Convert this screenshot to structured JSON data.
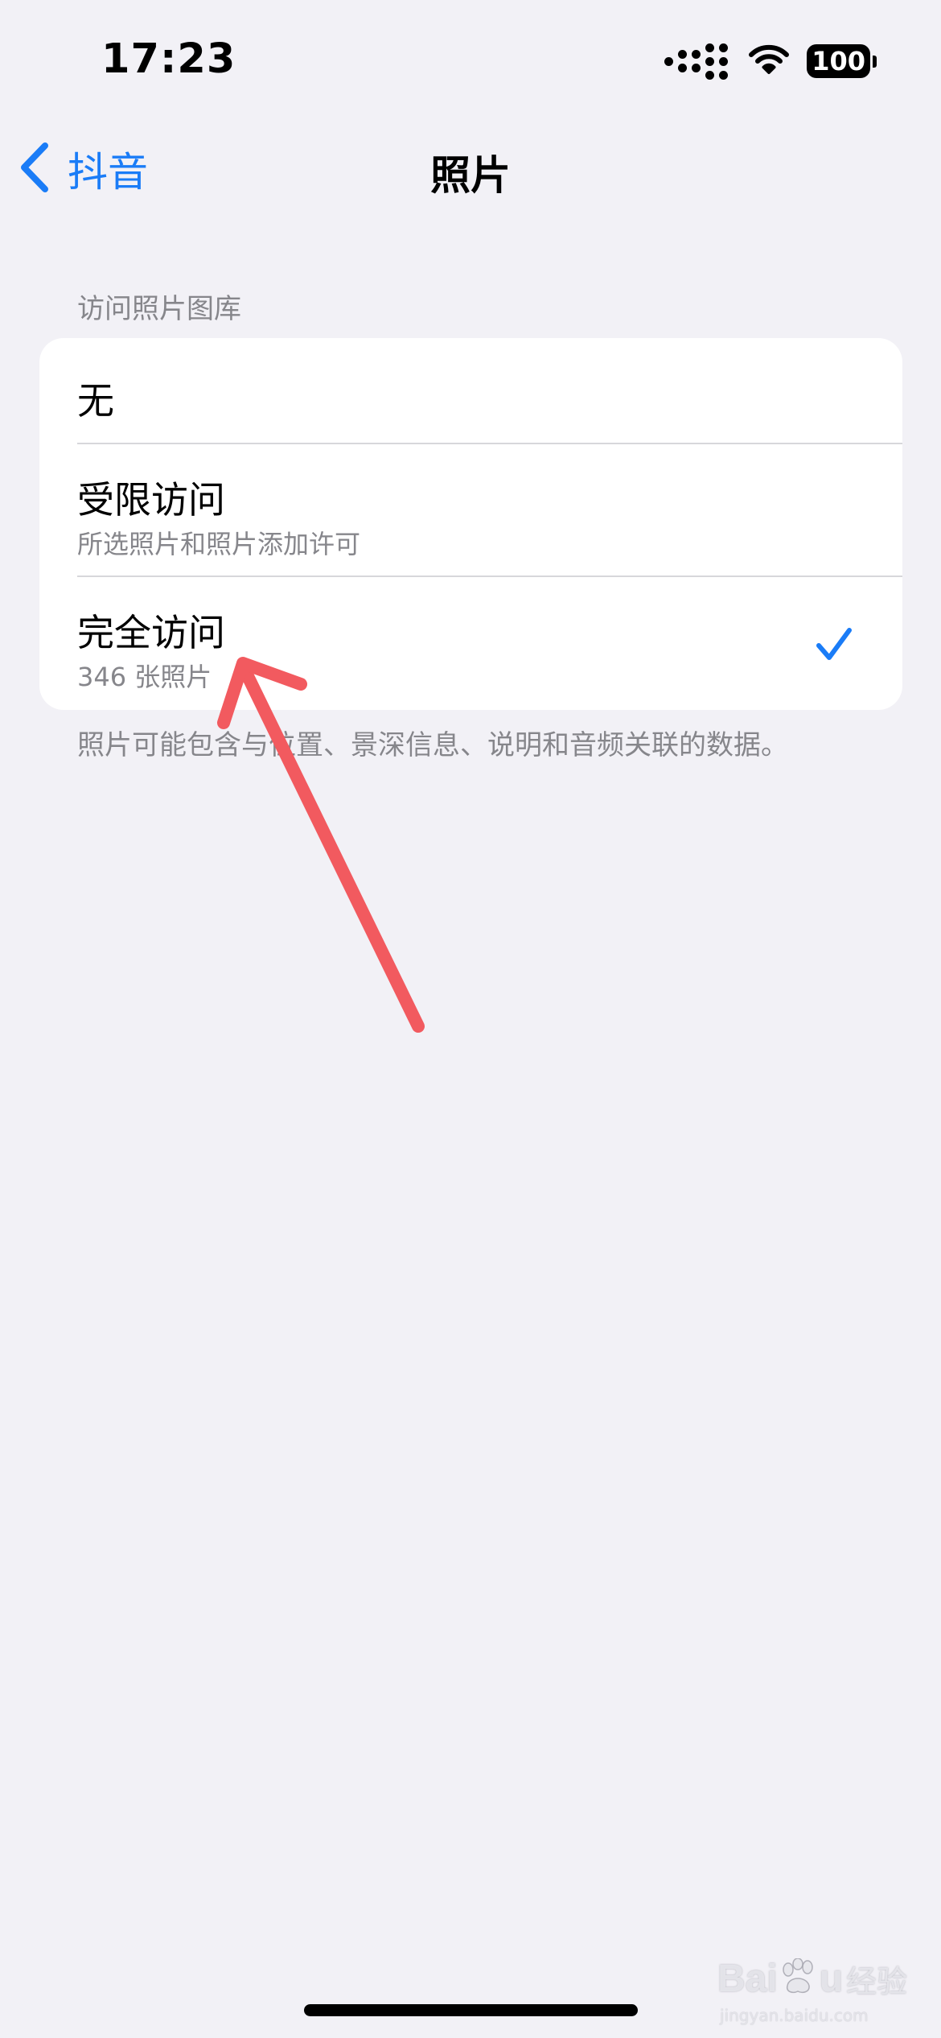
{
  "status_bar": {
    "time": "17:23",
    "battery": "100",
    "icons": [
      "signal-icon",
      "wifi-icon",
      "battery-icon"
    ]
  },
  "nav": {
    "back_label": "抖音",
    "title": "照片"
  },
  "section": {
    "header": "访问照片图库",
    "options": [
      {
        "title": "无",
        "subtitle": "",
        "selected": false
      },
      {
        "title": "受限访问",
        "subtitle": "所选照片和照片添加许可",
        "selected": false
      },
      {
        "title": "完全访问",
        "subtitle": "346 张照片",
        "selected": true
      }
    ],
    "footer": "照片可能包含与位置、景深信息、说明和音频关联的数据。"
  },
  "watermark": {
    "logo_left": "Bai",
    "logo_right": "u",
    "text": "经验",
    "url": "jingyan.baidu.com"
  },
  "colors": {
    "accent": "#1a7cf7",
    "background": "#f2f1f6",
    "annotation_arrow": "#f25a5f"
  }
}
